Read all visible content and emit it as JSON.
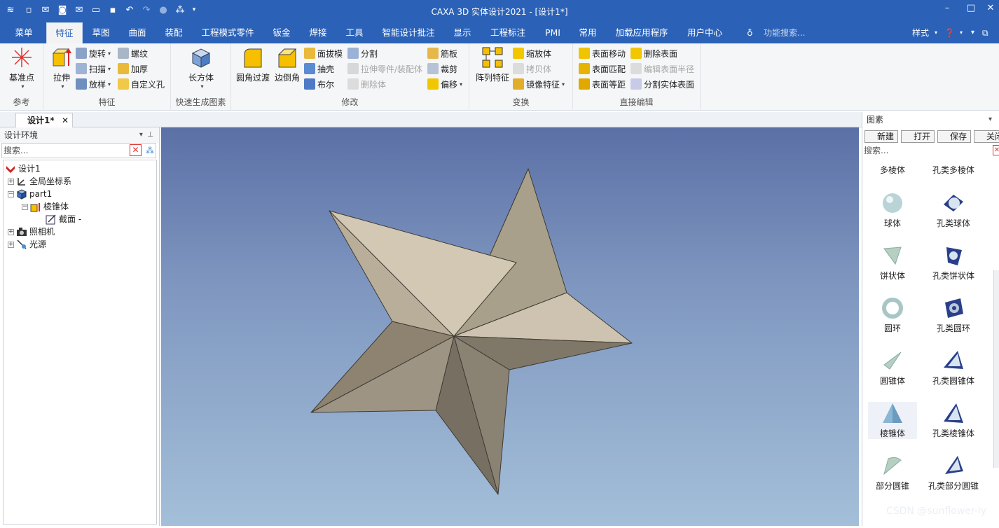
{
  "app": {
    "title": "CAXA 3D 实体设计2021 - [设计1*]"
  },
  "menu": {
    "tabs": [
      "菜单",
      "特征",
      "草图",
      "曲面",
      "装配",
      "工程模式零件",
      "钣金",
      "焊接",
      "工具",
      "智能设计批注",
      "显示",
      "工程标注",
      "PMI",
      "常用",
      "加载应用程序",
      "用户中心"
    ],
    "active": "特征",
    "search_placeholder": "功能搜索...",
    "style_label": "样式"
  },
  "ribbon": {
    "groups": {
      "reference": "参考",
      "feature": "特征",
      "quick": "快速生成图素",
      "modify": "修改",
      "transform": "变换",
      "direct": "直接编辑"
    },
    "reference": {
      "datum": "基准点"
    },
    "feature": {
      "extrude": "拉伸",
      "revolve": "旋转",
      "sweep": "扫描",
      "loft": "放样",
      "thread": "螺纹",
      "thicken": "加厚",
      "custom_hole": "自定义孔"
    },
    "quick": {
      "box": "长方体"
    },
    "modify": {
      "fillet": "圆角过渡",
      "chamfer": "边倒角",
      "draft": "面拔模",
      "shell": "抽壳",
      "boolean": "布尔",
      "split": "分割",
      "extrude_part": "拉伸零件/装配体",
      "delete_body": "删除体",
      "rib": "筋板",
      "trim": "裁剪",
      "offset": "偏移"
    },
    "transform": {
      "pattern": "阵列特征",
      "scale": "缩放体",
      "copy": "拷贝体",
      "mirror": "镜像特征"
    },
    "direct": {
      "move_face": "表面移动",
      "match_face": "表面匹配",
      "offset_face": "表面等距",
      "delete_face": "删除表面",
      "edit_radius": "编辑表面半径",
      "split_face": "分割实体表面"
    }
  },
  "doc": {
    "tab": "设计1*"
  },
  "left_panel": {
    "title": "设计环境",
    "search_placeholder": "搜索...",
    "tree": [
      "设计1",
      "全局坐标系",
      "part1",
      "棱锥体",
      "截面 -",
      "照相机",
      "光源"
    ]
  },
  "right_panel": {
    "title": "图素",
    "buttons": [
      "新建",
      "打开",
      "保存",
      "关闭"
    ],
    "search_placeholder": "搜索...",
    "items": [
      [
        "多棱体",
        "孔类多棱体"
      ],
      [
        "球体",
        "孔类球体"
      ],
      [
        "饼状体",
        "孔类饼状体"
      ],
      [
        "圆环",
        "孔类圆环"
      ],
      [
        "圆锥体",
        "孔类圆锥体"
      ],
      [
        "棱锥体",
        "孔类棱锥体"
      ],
      [
        "部分圆锥",
        "孔类部分圆锥"
      ]
    ]
  },
  "watermark": "CSDN @sunflower-ly",
  "colors": {
    "accent": "#2b62b8",
    "star_light": "#cdc3b0",
    "star_dark": "#8f8672"
  }
}
